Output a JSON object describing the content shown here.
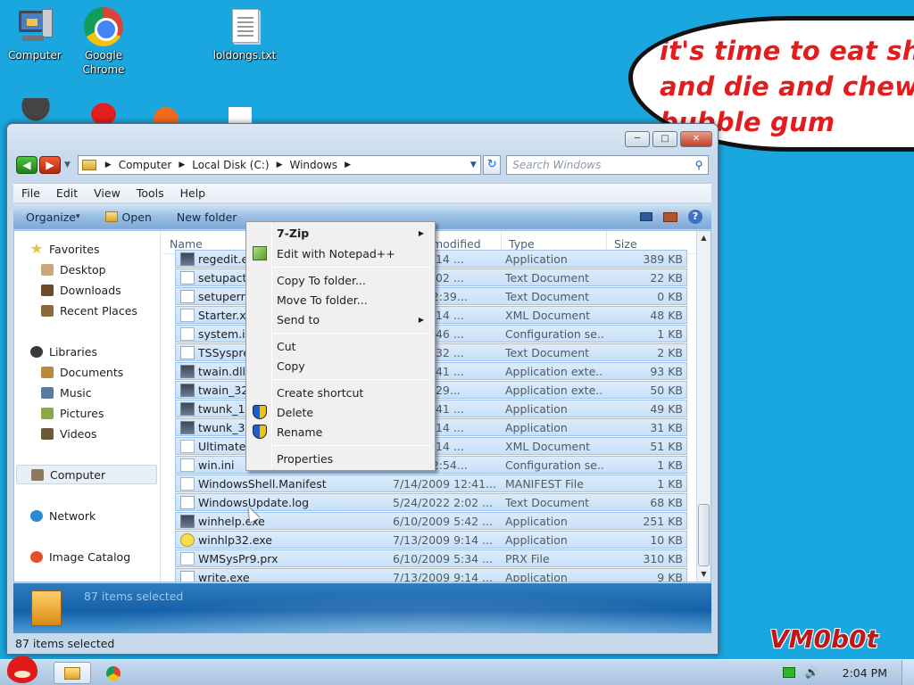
{
  "desktop": {
    "icons": [
      {
        "label": "Computer",
        "icon": "computer-icon"
      },
      {
        "label": "Google Chrome",
        "icon": "chrome-icon"
      },
      {
        "label": "loldongs.txt",
        "icon": "text-file-icon"
      }
    ],
    "bubble_text": "it's time to eat shit\nand die and chew\nbubble gum",
    "watermark": "VM0b0t"
  },
  "window": {
    "address": {
      "segments": [
        "Computer",
        "Local Disk (C:)",
        "Windows"
      ]
    },
    "search": {
      "placeholder": "Search Windows"
    },
    "menu": [
      "File",
      "Edit",
      "View",
      "Tools",
      "Help"
    ],
    "toolbar": {
      "organize": "Organize",
      "open": "Open",
      "new_folder": "New folder"
    },
    "nav": {
      "favorites": "Favorites",
      "desktop": "Desktop",
      "downloads": "Downloads",
      "recent": "Recent Places",
      "libraries": "Libraries",
      "documents": "Documents",
      "music": "Music",
      "pictures": "Pictures",
      "videos": "Videos",
      "computer": "Computer",
      "network": "Network",
      "image_catalog": "Image Catalog"
    },
    "columns": {
      "name": "Name",
      "modified": "modified",
      "type": "Type",
      "size": "Size"
    },
    "rows": [
      {
        "name": "regedit.exe",
        "date": "2009 9:14 ...",
        "type": "Application",
        "size": "389 KB",
        "icon": "exe"
      },
      {
        "name": "setupact.log",
        "date": "2022 2:02 ...",
        "type": "Text Document",
        "size": "22 KB",
        "icon": "txt"
      },
      {
        "name": "setuperr.log",
        "date": "2009 12:39...",
        "type": "Text Document",
        "size": "0 KB",
        "icon": "txt"
      },
      {
        "name": "Starter.xml",
        "date": "2009 5:14 ...",
        "type": "XML Document",
        "size": "48 KB",
        "icon": "ini"
      },
      {
        "name": "system.ini",
        "date": "2009 5:46 ...",
        "type": "Configuration se...",
        "size": "1 KB",
        "icon": "ini"
      },
      {
        "name": "TSSysprep",
        "date": "2022 9:32 ...",
        "type": "Text Document",
        "size": "2 KB",
        "icon": "txt"
      },
      {
        "name": "twain.dll",
        "date": "2009 5:41 ...",
        "type": "Application exte...",
        "size": "93 KB",
        "icon": "exe"
      },
      {
        "name": "twain_32.dll",
        "date": "2010 4:29...",
        "type": "Application exte...",
        "size": "50 KB",
        "icon": "exe"
      },
      {
        "name": "twunk_16.exe",
        "date": "2009 5:41 ...",
        "type": "Application",
        "size": "49 KB",
        "icon": "exe"
      },
      {
        "name": "twunk_32.exe",
        "date": "2009 9:14 ...",
        "type": "Application",
        "size": "31 KB",
        "icon": "exe"
      },
      {
        "name": "Ultimate.xml",
        "date": "2009 5:14 ...",
        "type": "XML Document",
        "size": "51 KB",
        "icon": "ini"
      },
      {
        "name": "win.ini",
        "date": "2009 12:54...",
        "type": "Configuration se...",
        "size": "1 KB",
        "icon": "ini"
      },
      {
        "name": "WindowsShell.Manifest",
        "date": "7/14/2009 12:41...",
        "type": "MANIFEST File",
        "size": "1 KB",
        "icon": "ini"
      },
      {
        "name": "WindowsUpdate.log",
        "date": "5/24/2022 2:02 ...",
        "type": "Text Document",
        "size": "68 KB",
        "icon": "txt"
      },
      {
        "name": "winhelp.exe",
        "date": "6/10/2009 5:42 ...",
        "type": "Application",
        "size": "251 KB",
        "icon": "exe"
      },
      {
        "name": "winhlp32.exe",
        "date": "7/13/2009 9:14 ...",
        "type": "Application",
        "size": "10 KB",
        "icon": "help"
      },
      {
        "name": "WMSysPr9.prx",
        "date": "6/10/2009 5:34 ...",
        "type": "PRX File",
        "size": "310 KB",
        "icon": "ini"
      },
      {
        "name": "write.exe",
        "date": "7/13/2009 9:14 ...",
        "type": "Application",
        "size": "9 KB",
        "icon": "txt"
      }
    ],
    "details": {
      "count": "87 items selected"
    },
    "status": "87 items selected"
  },
  "context_menu": {
    "items": [
      {
        "label": "7-Zip",
        "bold": true,
        "submenu": true
      },
      {
        "label": "Edit with Notepad++",
        "icon": "notepadpp-icon"
      },
      {
        "label": "Copy To folder..."
      },
      {
        "label": "Move To folder..."
      },
      {
        "label": "Send to",
        "submenu": true
      },
      {
        "label": "Cut"
      },
      {
        "label": "Copy"
      },
      {
        "label": "Create shortcut"
      },
      {
        "label": "Delete",
        "icon": "uac-shield-icon"
      },
      {
        "label": "Rename",
        "icon": "uac-shield-icon"
      },
      {
        "label": "Properties"
      }
    ]
  },
  "taskbar": {
    "clock": "2:04 PM"
  }
}
